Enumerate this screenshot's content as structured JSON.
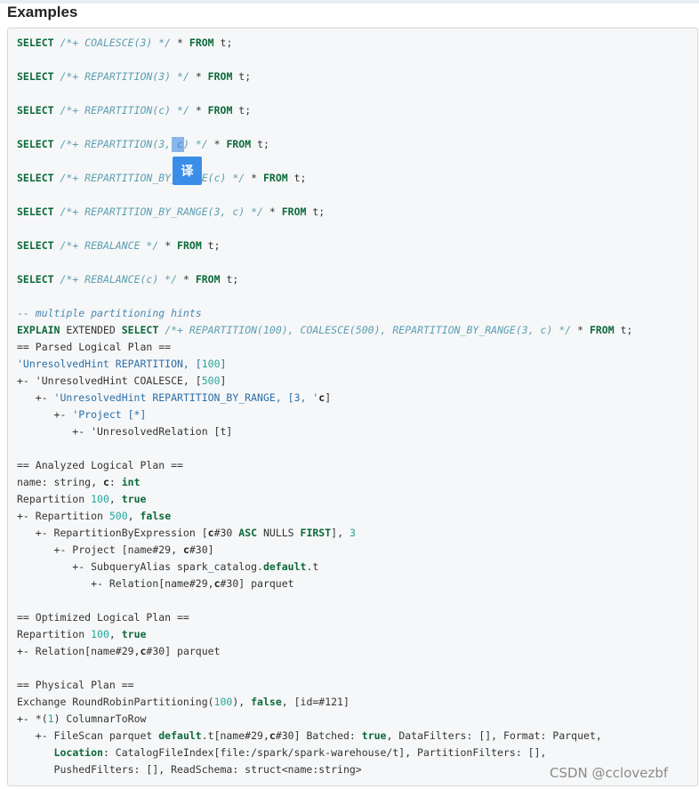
{
  "section": {
    "title": "Examples"
  },
  "translate_button": {
    "label": "译"
  },
  "watermark": "CSDN @cclovezbf",
  "code_lines": [
    [
      [
        "kw",
        "SELECT"
      ],
      [
        "p",
        " "
      ],
      [
        "hint",
        "/*+ COALESCE(3) */"
      ],
      [
        "p",
        " * "
      ],
      [
        "kw",
        "FROM"
      ],
      [
        "p",
        " t;"
      ]
    ],
    [
      [
        "kw",
        "SELECT"
      ],
      [
        "p",
        " "
      ],
      [
        "hint",
        "/*+ REPARTITION(3) */"
      ],
      [
        "p",
        " * "
      ],
      [
        "kw",
        "FROM"
      ],
      [
        "p",
        " t;"
      ]
    ],
    [
      [
        "kw",
        "SELECT"
      ],
      [
        "p",
        " "
      ],
      [
        "hint",
        "/*+ REPARTITION(c) */"
      ],
      [
        "p",
        " * "
      ],
      [
        "kw",
        "FROM"
      ],
      [
        "p",
        " t;"
      ]
    ],
    [
      [
        "kw",
        "SELECT"
      ],
      [
        "p",
        " "
      ],
      [
        "hint",
        "/*+ REPARTITION(3, c) */"
      ],
      [
        "p",
        " * "
      ],
      [
        "kw",
        "FROM"
      ],
      [
        "p",
        " t;"
      ]
    ],
    [
      [
        "kw",
        "SELECT"
      ],
      [
        "p",
        " "
      ],
      [
        "hint",
        "/*+ REPARTITION_BY_RANGE(c) */"
      ],
      [
        "p",
        " * "
      ],
      [
        "kw",
        "FROM"
      ],
      [
        "p",
        " t;"
      ]
    ],
    [
      [
        "kw",
        "SELECT"
      ],
      [
        "p",
        " "
      ],
      [
        "hint",
        "/*+ REPARTITION_BY_RANGE(3, c) */"
      ],
      [
        "p",
        " * "
      ],
      [
        "kw",
        "FROM"
      ],
      [
        "p",
        " t;"
      ]
    ],
    [
      [
        "kw",
        "SELECT"
      ],
      [
        "p",
        " "
      ],
      [
        "hint",
        "/*+ REBALANCE */"
      ],
      [
        "p",
        " * "
      ],
      [
        "kw",
        "FROM"
      ],
      [
        "p",
        " t;"
      ]
    ],
    [
      [
        "kw",
        "SELECT"
      ],
      [
        "p",
        " "
      ],
      [
        "hint",
        "/*+ REBALANCE(c) */"
      ],
      [
        "p",
        " * "
      ],
      [
        "kw",
        "FROM"
      ],
      [
        "p",
        " t;"
      ]
    ],
    [
      [
        "cmt",
        "-- multiple partitioning hints"
      ]
    ],
    [
      [
        "kw",
        "EXPLAIN"
      ],
      [
        "p",
        " EXTENDED "
      ],
      [
        "kw",
        "SELECT"
      ],
      [
        "p",
        " "
      ],
      [
        "hint",
        "/*+ REPARTITION(100), COALESCE(500), REPARTITION_BY_RANGE(3, c) */"
      ],
      [
        "p",
        " * "
      ],
      [
        "kw",
        "FROM"
      ],
      [
        "p",
        " t;"
      ]
    ],
    [
      [
        "p",
        "== Parsed Logical Plan =="
      ]
    ],
    [
      [
        "blu",
        "'UnresolvedHint REPARTITION, ["
      ],
      [
        "num",
        "100"
      ],
      [
        "blu",
        "]"
      ]
    ],
    [
      [
        "p",
        "+- 'UnresolvedHint COALESCE, ["
      ],
      [
        "num",
        "500"
      ],
      [
        "p",
        "]"
      ]
    ],
    [
      [
        "p",
        "   +- "
      ],
      [
        "blu",
        "'UnresolvedHint REPARTITION_BY_RANGE, [3, '"
      ],
      [
        "cbold",
        "c"
      ],
      [
        "p",
        "]"
      ]
    ],
    [
      [
        "p",
        "      +- "
      ],
      [
        "blu",
        "'Project [*]"
      ]
    ],
    [
      [
        "p",
        "         +- 'UnresolvedRelation [t]"
      ]
    ],
    [
      [
        "p",
        ""
      ]
    ],
    [
      [
        "p",
        "== Analyzed Logical Plan =="
      ]
    ],
    [
      [
        "p",
        "name: string, "
      ],
      [
        "cbold",
        "c"
      ],
      [
        "p",
        ": "
      ],
      [
        "kw",
        "int"
      ]
    ],
    [
      [
        "p",
        "Repartition "
      ],
      [
        "num",
        "100"
      ],
      [
        "p",
        ", "
      ],
      [
        "kw",
        "true"
      ]
    ],
    [
      [
        "p",
        "+- Repartition "
      ],
      [
        "num",
        "500"
      ],
      [
        "p",
        ", "
      ],
      [
        "kw",
        "false"
      ]
    ],
    [
      [
        "p",
        "   +- RepartitionByExpression ["
      ],
      [
        "cbold",
        "c"
      ],
      [
        "p",
        "#30 "
      ],
      [
        "kw",
        "ASC"
      ],
      [
        "p",
        " NULLS "
      ],
      [
        "kw",
        "FIRST"
      ],
      [
        "p",
        "], "
      ],
      [
        "num",
        "3"
      ]
    ],
    [
      [
        "p",
        "      +- Project [name#29, "
      ],
      [
        "cbold",
        "c"
      ],
      [
        "p",
        "#30]"
      ]
    ],
    [
      [
        "p",
        "         +- SubqueryAlias spark_catalog."
      ],
      [
        "kw",
        "default"
      ],
      [
        "p",
        ".t"
      ]
    ],
    [
      [
        "p",
        "            +- Relation[name#29,"
      ],
      [
        "cbold",
        "c"
      ],
      [
        "p",
        "#30] parquet"
      ]
    ],
    [
      [
        "p",
        ""
      ]
    ],
    [
      [
        "p",
        "== Optimized Logical Plan =="
      ]
    ],
    [
      [
        "p",
        "Repartition "
      ],
      [
        "num",
        "100"
      ],
      [
        "p",
        ", "
      ],
      [
        "kw",
        "true"
      ]
    ],
    [
      [
        "p",
        "+- Relation[name#29,"
      ],
      [
        "cbold",
        "c"
      ],
      [
        "p",
        "#30] parquet"
      ]
    ],
    [
      [
        "p",
        ""
      ]
    ],
    [
      [
        "p",
        "== Physical Plan =="
      ]
    ],
    [
      [
        "p",
        "Exchange RoundRobinPartitioning("
      ],
      [
        "num",
        "100"
      ],
      [
        "p",
        "), "
      ],
      [
        "kw",
        "false"
      ],
      [
        "p",
        ", [id=#121]"
      ]
    ],
    [
      [
        "p",
        "+- *("
      ],
      [
        "num",
        "1"
      ],
      [
        "p",
        ") ColumnarToRow"
      ]
    ],
    [
      [
        "p",
        "   +- FileScan parquet "
      ],
      [
        "kw",
        "default"
      ],
      [
        "p",
        ".t[name#29,"
      ],
      [
        "cbold",
        "c"
      ],
      [
        "p",
        "#30] Batched: "
      ],
      [
        "kw",
        "true"
      ],
      [
        "p",
        ", DataFilters: [], Format: Parquet,"
      ]
    ],
    [
      [
        "p",
        "      "
      ],
      [
        "kw",
        "Location"
      ],
      [
        "p",
        ": CatalogFileIndex[file:/spark/spark-warehouse/t], PartitionFilters: [],"
      ]
    ],
    [
      [
        "p",
        "      PushedFilters: [], ReadSchema: struct<name:string>"
      ]
    ]
  ],
  "code_line_tops": [
    48,
    86,
    124,
    162,
    200,
    238,
    276,
    314,
    352,
    371,
    390,
    409,
    428,
    447,
    466,
    485,
    504,
    523,
    542,
    561,
    580,
    599,
    618,
    637,
    656,
    675,
    694,
    713,
    732,
    751,
    770,
    789,
    808,
    827,
    846,
    865
  ]
}
